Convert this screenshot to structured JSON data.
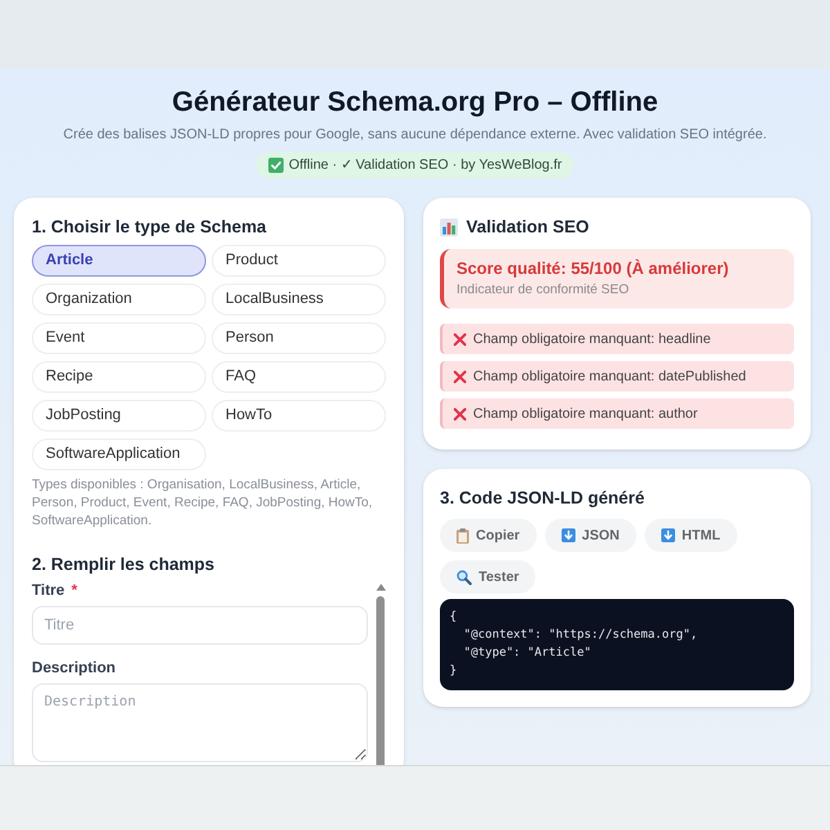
{
  "header": {
    "title": "Générateur Schema.org Pro – Offline",
    "subtitle": "Crée des balises JSON-LD propres pour Google, sans aucune dépendance externe. Avec validation SEO intégrée.",
    "badge": "Offline · ✓ Validation SEO · by YesWeBlog.fr"
  },
  "schema_types": {
    "title": "1. Choisir le type de Schema",
    "types": [
      {
        "label": "Article",
        "selected": true
      },
      {
        "label": "Product",
        "selected": false
      },
      {
        "label": "Organization",
        "selected": false
      },
      {
        "label": "LocalBusiness",
        "selected": false
      },
      {
        "label": "Event",
        "selected": false
      },
      {
        "label": "Person",
        "selected": false
      },
      {
        "label": "Recipe",
        "selected": false
      },
      {
        "label": "FAQ",
        "selected": false
      },
      {
        "label": "JobPosting",
        "selected": false
      },
      {
        "label": "HowTo",
        "selected": false
      },
      {
        "label": "SoftwareApplication",
        "selected": false
      }
    ],
    "help": "Types disponibles : Organisation, LocalBusiness, Article, Person, Product, Event, Recipe, FAQ, JobPosting, HowTo, SoftwareApplication."
  },
  "fields_section": {
    "title": "2. Remplir les champs",
    "fields": [
      {
        "kind": "input",
        "label": "Titre",
        "required_mark": "*",
        "placeholder": "Titre"
      },
      {
        "kind": "textarea",
        "label": "Description",
        "placeholder": "Description"
      }
    ]
  },
  "validation": {
    "title": "Validation SEO",
    "score": "Score qualité: 55/100 (À améliorer)",
    "score_note": "Indicateur de conformité SEO",
    "errors": [
      "Champ obligatoire manquant: headline",
      "Champ obligatoire manquant: datePublished",
      "Champ obligatoire manquant: author"
    ]
  },
  "code_output": {
    "title": "3. Code JSON-LD généré",
    "actions": [
      {
        "kind": "copy",
        "label": "Copier"
      },
      {
        "kind": "download",
        "label": "JSON"
      },
      {
        "kind": "download",
        "label": "HTML"
      },
      {
        "kind": "test",
        "label": "Tester"
      }
    ],
    "code_lines": [
      "{",
      "  \"@context\": \"https://schema.org\",",
      "  \"@type\": \"Article\"",
      "}"
    ]
  }
}
